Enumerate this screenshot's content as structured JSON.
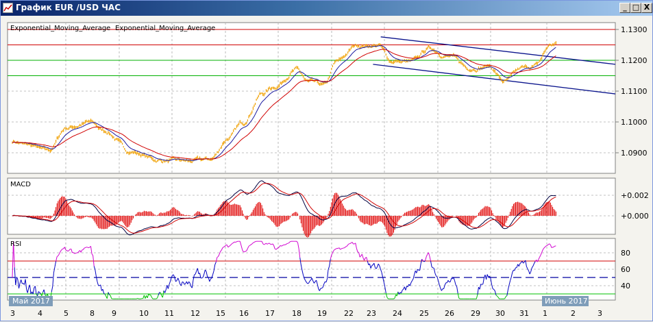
{
  "window": {
    "title": "График EUR /USD ЧАС",
    "minimize": "_",
    "maximize": "□",
    "close": "X"
  },
  "legend": {
    "ema1": "Exponential_Moving_Average",
    "ema2": "Exponential_Moving_Average",
    "ema1_color": "#1a1aa0",
    "ema2_color": "#d00000"
  },
  "colors": {
    "price": "#f0a000",
    "resistance": "#d00000",
    "support": "#00b000",
    "channel": "#0a148c",
    "macd": "#000040",
    "signal": "#d00000",
    "rsi": "#0000c0",
    "rsi_over": "#d000d0",
    "rsi_under": "#00c000"
  },
  "chart_data": [
    {
      "type": "line",
      "title": "EUR/USD H1",
      "price_axis": {
        "ylim": [
          1.0855,
          1.1322
        ],
        "ticks": [
          "1.1300",
          "1.1200",
          "1.1100",
          "1.1000",
          "1.0900"
        ],
        "tick_values": [
          1.13,
          1.12,
          1.11,
          1.1,
          1.09
        ]
      },
      "price_keypoints": [
        [
          0,
          1.0938
        ],
        [
          0.6,
          1.0925
        ],
        [
          1.4,
          1.0904
        ],
        [
          2.1,
          1.0982
        ],
        [
          3.0,
          1.0998
        ],
        [
          3.6,
          1.097
        ],
        [
          4.6,
          1.0904
        ],
        [
          5.7,
          1.0876
        ],
        [
          6.8,
          1.0871
        ],
        [
          7.7,
          1.0878
        ],
        [
          8.4,
          1.0949
        ],
        [
          8.9,
          1.0993
        ],
        [
          9.7,
          1.1093
        ],
        [
          10.2,
          1.1116
        ],
        [
          11.0,
          1.1171
        ],
        [
          11.5,
          1.1127
        ],
        [
          12.1,
          1.1116
        ],
        [
          12.6,
          1.1193
        ],
        [
          13.4,
          1.1249
        ],
        [
          14.2,
          1.1249
        ],
        [
          14.7,
          1.1198
        ],
        [
          15.5,
          1.1193
        ],
        [
          16.2,
          1.1238
        ],
        [
          16.9,
          1.1216
        ],
        [
          17.7,
          1.1176
        ],
        [
          18.5,
          1.1182
        ],
        [
          19.1,
          1.1131
        ],
        [
          19.8,
          1.1171
        ],
        [
          20.3,
          1.1182
        ],
        [
          20.9,
          1.1249
        ],
        [
          21.1,
          1.1252
        ]
      ],
      "horizontal_levels": [
        {
          "price": 1.13,
          "kind": "resistance"
        },
        {
          "price": 1.125,
          "kind": "resistance"
        },
        {
          "price": 1.12,
          "kind": "support"
        },
        {
          "price": 1.115,
          "kind": "support"
        }
      ],
      "channel": [
        {
          "from": [
            14.3,
            1.1276
          ],
          "to": [
            23.5,
            1.1187
          ]
        },
        {
          "from": [
            14.0,
            1.1187
          ],
          "to": [
            23.5,
            1.1091
          ]
        }
      ],
      "ema_periods": [
        12,
        34
      ]
    },
    {
      "type": "line",
      "title": "MACD",
      "ylim": [
        -0.0018,
        0.0037
      ],
      "ticks": [
        "+0.002",
        "+0.000"
      ],
      "tick_values": [
        0.002,
        0.0
      ]
    },
    {
      "type": "line",
      "title": "RSI",
      "ylim": [
        22,
        96
      ],
      "ticks": [
        "80",
        "60",
        "40"
      ],
      "tick_values": [
        80,
        60,
        40
      ],
      "levels": [
        70,
        50,
        30
      ]
    }
  ],
  "xaxis": {
    "labels": [
      "3",
      "4",
      "5",
      "8",
      "9",
      "10",
      "11",
      "12",
      "15",
      "16",
      "17",
      "18",
      "19",
      "22",
      "23",
      "24",
      "25",
      "26",
      "29",
      "30",
      "31",
      "1",
      "2",
      "3"
    ],
    "month_start": "Май 2017",
    "month_next": "Июнь 2017"
  }
}
